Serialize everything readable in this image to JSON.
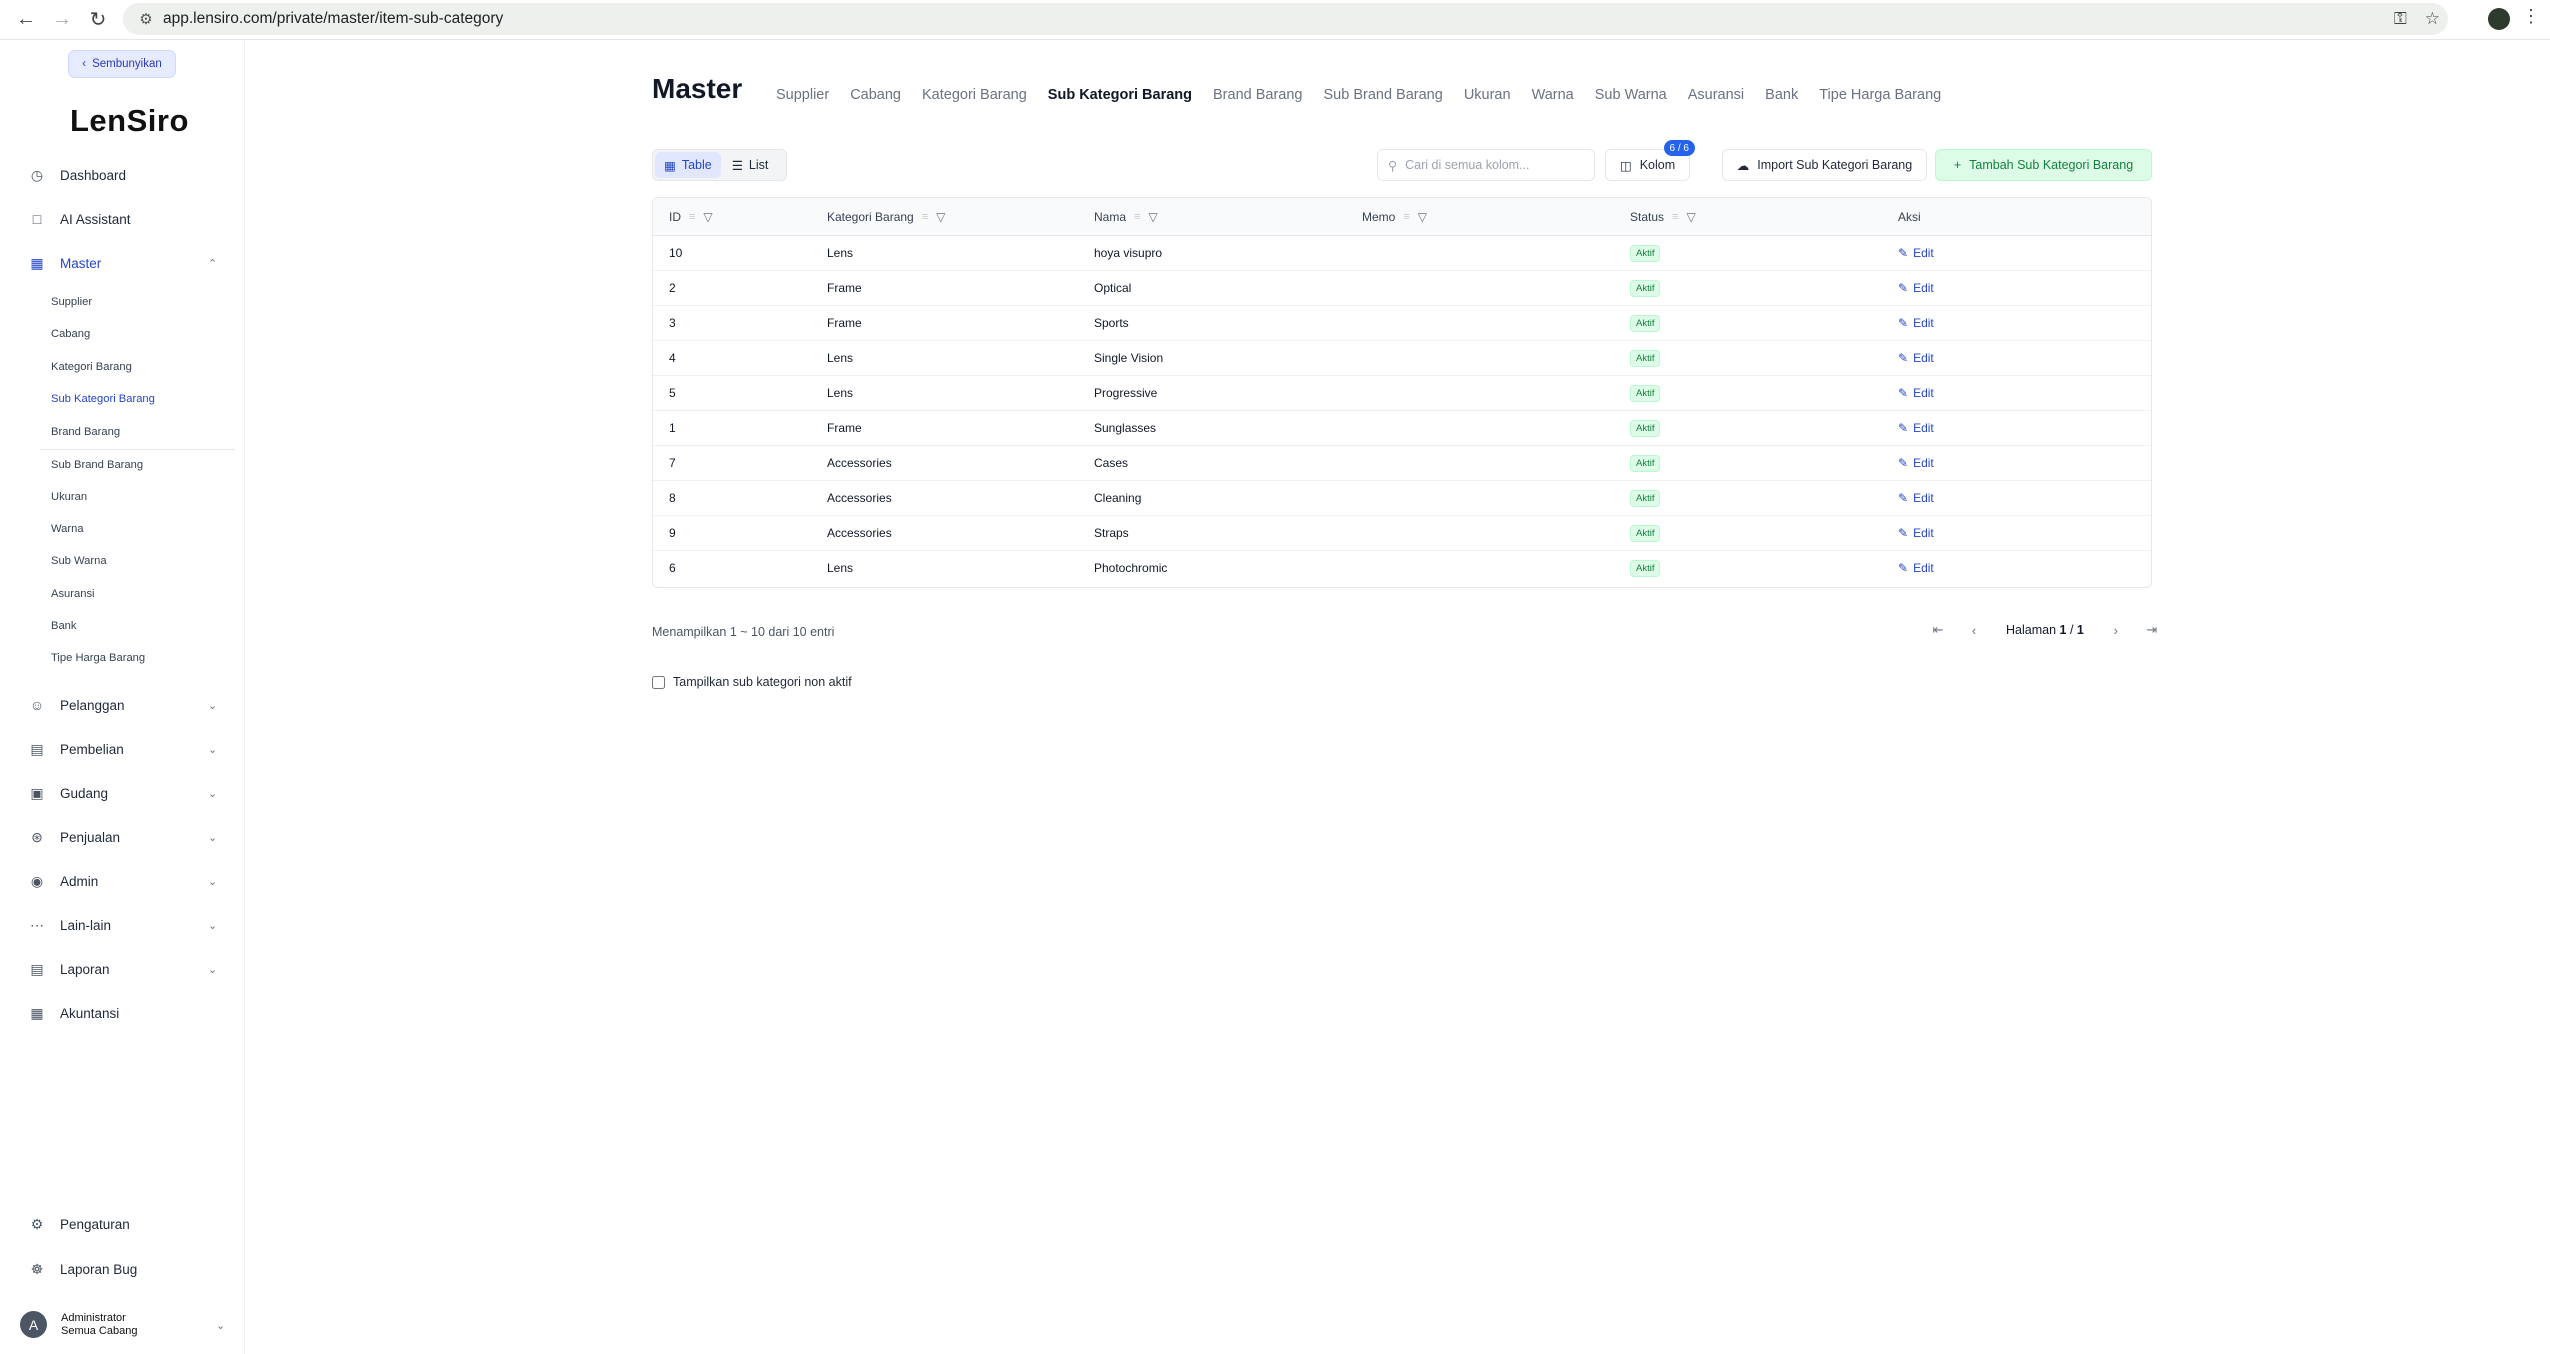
{
  "browser": {
    "url": "app.lensiro.com/private/master/item-sub-category"
  },
  "sidebar": {
    "hide_label": "Sembunyikan",
    "logo": "LenSiro",
    "items": [
      {
        "label": "Dashboard",
        "icon": "dashboard-icon"
      },
      {
        "label": "AI Assistant",
        "icon": "chat-icon"
      },
      {
        "label": "Master",
        "icon": "grid-icon"
      },
      {
        "label": "Pelanggan",
        "icon": "users-icon"
      },
      {
        "label": "Pembelian",
        "icon": "receipt-icon"
      },
      {
        "label": "Gudang",
        "icon": "warehouse-icon"
      },
      {
        "label": "Penjualan",
        "icon": "cart-icon"
      },
      {
        "label": "Admin",
        "icon": "admin-icon"
      },
      {
        "label": "Lain-lain",
        "icon": "more-icon"
      },
      {
        "label": "Laporan",
        "icon": "report-icon"
      },
      {
        "label": "Akuntansi",
        "icon": "accounting-icon"
      },
      {
        "label": "Pengaturan",
        "icon": "gear-icon"
      },
      {
        "label": "Laporan Bug",
        "icon": "bug-icon"
      }
    ],
    "master_sub": [
      "Supplier",
      "Cabang",
      "Kategori Barang",
      "Sub Kategori Barang",
      "Brand Barang",
      "Sub Brand Barang",
      "Ukuran",
      "Warna",
      "Sub Warna",
      "Asuransi",
      "Bank",
      "Tipe Harga Barang"
    ],
    "user": {
      "name": "Administrator",
      "branch": "Semua Cabang",
      "initial": "A"
    }
  },
  "main": {
    "title": "Master",
    "tabs": [
      "Supplier",
      "Cabang",
      "Kategori Barang",
      "Sub Kategori Barang",
      "Brand Barang",
      "Sub Brand Barang",
      "Ukuran",
      "Warna",
      "Sub Warna",
      "Asuransi",
      "Bank",
      "Tipe Harga Barang"
    ],
    "active_tab": "Sub Kategori Barang",
    "view_table": "Table",
    "view_list": "List",
    "search_placeholder": "Cari di semua kolom...",
    "kolom_label": "Kolom",
    "kolom_badge": "6 / 6",
    "import_label": "Import Sub Kategori Barang",
    "add_label": "Tambah Sub Kategori Barang",
    "columns": [
      "ID",
      "Kategori Barang",
      "Nama",
      "Memo",
      "Status",
      "Aksi"
    ],
    "rows": [
      {
        "id": "10",
        "kategori": "Lens",
        "nama": "hoya visupro",
        "memo": "",
        "status": "Aktif",
        "aksi": "Edit"
      },
      {
        "id": "2",
        "kategori": "Frame",
        "nama": "Optical",
        "memo": "",
        "status": "Aktif",
        "aksi": "Edit"
      },
      {
        "id": "3",
        "kategori": "Frame",
        "nama": "Sports",
        "memo": "",
        "status": "Aktif",
        "aksi": "Edit"
      },
      {
        "id": "4",
        "kategori": "Lens",
        "nama": "Single Vision",
        "memo": "",
        "status": "Aktif",
        "aksi": "Edit"
      },
      {
        "id": "5",
        "kategori": "Lens",
        "nama": "Progressive",
        "memo": "",
        "status": "Aktif",
        "aksi": "Edit"
      },
      {
        "id": "1",
        "kategori": "Frame",
        "nama": "Sunglasses",
        "memo": "",
        "status": "Aktif",
        "aksi": "Edit"
      },
      {
        "id": "7",
        "kategori": "Accessories",
        "nama": "Cases",
        "memo": "",
        "status": "Aktif",
        "aksi": "Edit"
      },
      {
        "id": "8",
        "kategori": "Accessories",
        "nama": "Cleaning",
        "memo": "",
        "status": "Aktif",
        "aksi": "Edit"
      },
      {
        "id": "9",
        "kategori": "Accessories",
        "nama": "Straps",
        "memo": "",
        "status": "Aktif",
        "aksi": "Edit"
      },
      {
        "id": "6",
        "kategori": "Lens",
        "nama": "Photochromic",
        "memo": "",
        "status": "Aktif",
        "aksi": "Edit"
      }
    ],
    "showing": "Menampilkan 1 ~ 10 dari 10 entri",
    "page_label": "Halaman",
    "page_current": "1",
    "page_total": "1",
    "show_inactive_label": "Tampilkan sub kategori non aktif"
  },
  "colors": {
    "accent": "#2546c4",
    "success_bg": "#dcfce7",
    "success_text": "#15803d"
  }
}
